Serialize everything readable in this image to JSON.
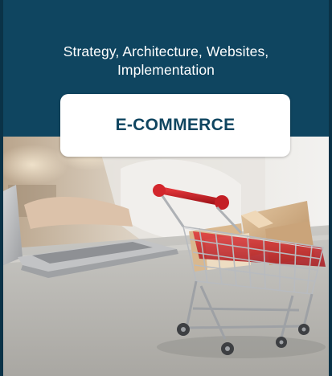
{
  "subtitle": {
    "line1": "Strategy, Architecture, Websites,",
    "line2": "Implementation"
  },
  "title": "E-COMMERCE",
  "colors": {
    "header_bg": "#0f4560",
    "title_box_bg": "#ffffff",
    "title_text": "#0f4560",
    "cart_handle": "#d3262c"
  },
  "image": {
    "subject": "shopping cart with boxes beside laptop",
    "icon": "shopping-cart-photo"
  }
}
